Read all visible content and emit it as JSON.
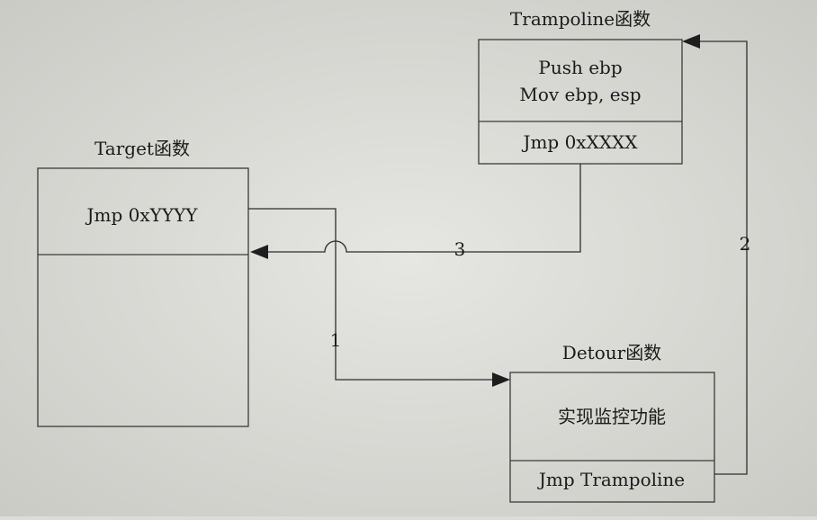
{
  "trampoline": {
    "title": "Trampoline函数",
    "line1": "Push ebp",
    "line2": "Mov ebp, esp",
    "jump": "Jmp 0xXXXX"
  },
  "target": {
    "title": "Target函数",
    "jump": "Jmp 0xYYYY"
  },
  "detour": {
    "title": "Detour函数",
    "body": "实现监控功能",
    "jump": "Jmp Trampoline"
  },
  "edges": {
    "step1": "1",
    "step2": "2",
    "step3": "3"
  }
}
